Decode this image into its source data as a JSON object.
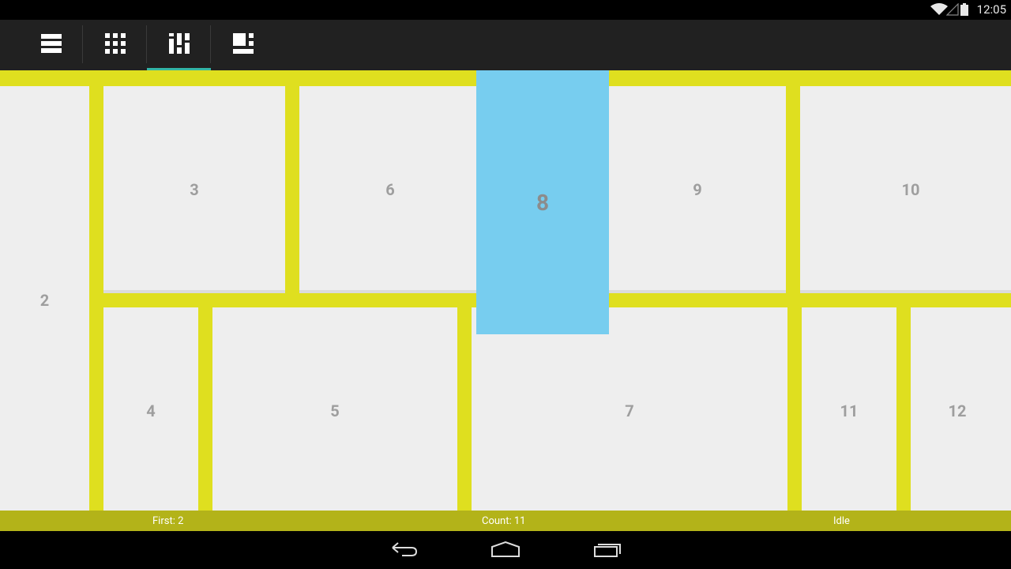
{
  "status_bar": {
    "time": "12:05",
    "icons": [
      "wifi-icon",
      "signal-icon",
      "battery-icon"
    ]
  },
  "action_bar": {
    "tabs": [
      {
        "icon": "list-layout-icon",
        "selected": false
      },
      {
        "icon": "grid-layout-icon",
        "selected": false
      },
      {
        "icon": "staggered-grid-layout-icon",
        "selected": true
      },
      {
        "icon": "spannable-grid-layout-icon",
        "selected": false
      }
    ],
    "accent": "#33b5a5"
  },
  "grid": {
    "background": "#dfdf1f",
    "cell_color": "#eeeeee",
    "selected_color": "#77cdef",
    "items": [
      {
        "label": "2"
      },
      {
        "label": "3"
      },
      {
        "label": "4"
      },
      {
        "label": "5"
      },
      {
        "label": "6"
      },
      {
        "label": "7"
      },
      {
        "label": "8",
        "selected": true
      },
      {
        "label": "9"
      },
      {
        "label": "10"
      },
      {
        "label": "11"
      },
      {
        "label": "12"
      }
    ]
  },
  "footer": {
    "first": "First: 2",
    "count": "Count: 11",
    "state": "Idle",
    "background": "#b3b319"
  },
  "nav_bar": {
    "buttons": [
      "back-icon",
      "home-icon",
      "recent-apps-icon"
    ]
  }
}
